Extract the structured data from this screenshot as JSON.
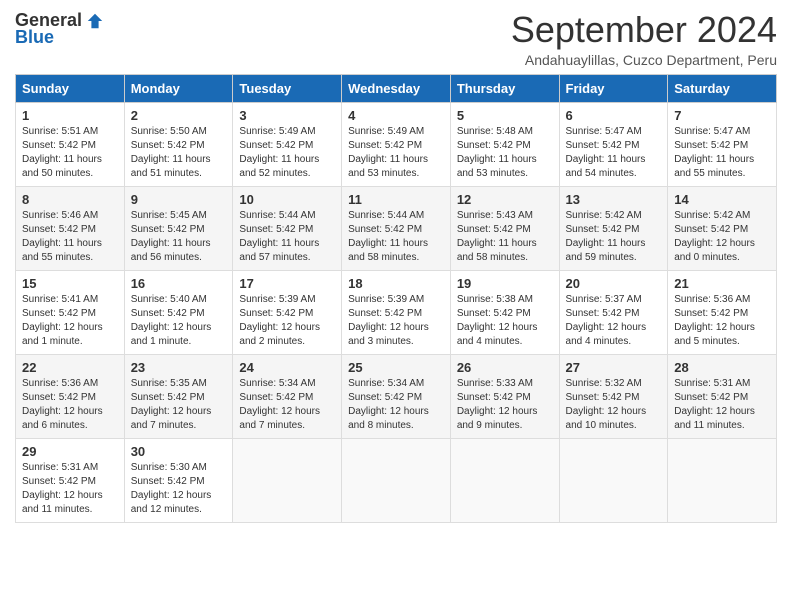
{
  "header": {
    "logo_general": "General",
    "logo_blue": "Blue",
    "month_title": "September 2024",
    "location": "Andahuaylillas, Cuzco Department, Peru"
  },
  "weekdays": [
    "Sunday",
    "Monday",
    "Tuesday",
    "Wednesday",
    "Thursday",
    "Friday",
    "Saturday"
  ],
  "weeks": [
    [
      {
        "day": "1",
        "sunrise": "5:51 AM",
        "sunset": "5:42 PM",
        "daylight": "11 hours and 50 minutes."
      },
      {
        "day": "2",
        "sunrise": "5:50 AM",
        "sunset": "5:42 PM",
        "daylight": "11 hours and 51 minutes."
      },
      {
        "day": "3",
        "sunrise": "5:49 AM",
        "sunset": "5:42 PM",
        "daylight": "11 hours and 52 minutes."
      },
      {
        "day": "4",
        "sunrise": "5:49 AM",
        "sunset": "5:42 PM",
        "daylight": "11 hours and 53 minutes."
      },
      {
        "day": "5",
        "sunrise": "5:48 AM",
        "sunset": "5:42 PM",
        "daylight": "11 hours and 53 minutes."
      },
      {
        "day": "6",
        "sunrise": "5:47 AM",
        "sunset": "5:42 PM",
        "daylight": "11 hours and 54 minutes."
      },
      {
        "day": "7",
        "sunrise": "5:47 AM",
        "sunset": "5:42 PM",
        "daylight": "11 hours and 55 minutes."
      }
    ],
    [
      {
        "day": "8",
        "sunrise": "5:46 AM",
        "sunset": "5:42 PM",
        "daylight": "11 hours and 55 minutes."
      },
      {
        "day": "9",
        "sunrise": "5:45 AM",
        "sunset": "5:42 PM",
        "daylight": "11 hours and 56 minutes."
      },
      {
        "day": "10",
        "sunrise": "5:44 AM",
        "sunset": "5:42 PM",
        "daylight": "11 hours and 57 minutes."
      },
      {
        "day": "11",
        "sunrise": "5:44 AM",
        "sunset": "5:42 PM",
        "daylight": "11 hours and 58 minutes."
      },
      {
        "day": "12",
        "sunrise": "5:43 AM",
        "sunset": "5:42 PM",
        "daylight": "11 hours and 58 minutes."
      },
      {
        "day": "13",
        "sunrise": "5:42 AM",
        "sunset": "5:42 PM",
        "daylight": "11 hours and 59 minutes."
      },
      {
        "day": "14",
        "sunrise": "5:42 AM",
        "sunset": "5:42 PM",
        "daylight": "12 hours and 0 minutes."
      }
    ],
    [
      {
        "day": "15",
        "sunrise": "5:41 AM",
        "sunset": "5:42 PM",
        "daylight": "12 hours and 1 minute."
      },
      {
        "day": "16",
        "sunrise": "5:40 AM",
        "sunset": "5:42 PM",
        "daylight": "12 hours and 1 minute."
      },
      {
        "day": "17",
        "sunrise": "5:39 AM",
        "sunset": "5:42 PM",
        "daylight": "12 hours and 2 minutes."
      },
      {
        "day": "18",
        "sunrise": "5:39 AM",
        "sunset": "5:42 PM",
        "daylight": "12 hours and 3 minutes."
      },
      {
        "day": "19",
        "sunrise": "5:38 AM",
        "sunset": "5:42 PM",
        "daylight": "12 hours and 4 minutes."
      },
      {
        "day": "20",
        "sunrise": "5:37 AM",
        "sunset": "5:42 PM",
        "daylight": "12 hours and 4 minutes."
      },
      {
        "day": "21",
        "sunrise": "5:36 AM",
        "sunset": "5:42 PM",
        "daylight": "12 hours and 5 minutes."
      }
    ],
    [
      {
        "day": "22",
        "sunrise": "5:36 AM",
        "sunset": "5:42 PM",
        "daylight": "12 hours and 6 minutes."
      },
      {
        "day": "23",
        "sunrise": "5:35 AM",
        "sunset": "5:42 PM",
        "daylight": "12 hours and 7 minutes."
      },
      {
        "day": "24",
        "sunrise": "5:34 AM",
        "sunset": "5:42 PM",
        "daylight": "12 hours and 7 minutes."
      },
      {
        "day": "25",
        "sunrise": "5:34 AM",
        "sunset": "5:42 PM",
        "daylight": "12 hours and 8 minutes."
      },
      {
        "day": "26",
        "sunrise": "5:33 AM",
        "sunset": "5:42 PM",
        "daylight": "12 hours and 9 minutes."
      },
      {
        "day": "27",
        "sunrise": "5:32 AM",
        "sunset": "5:42 PM",
        "daylight": "12 hours and 10 minutes."
      },
      {
        "day": "28",
        "sunrise": "5:31 AM",
        "sunset": "5:42 PM",
        "daylight": "12 hours and 11 minutes."
      }
    ],
    [
      {
        "day": "29",
        "sunrise": "5:31 AM",
        "sunset": "5:42 PM",
        "daylight": "12 hours and 11 minutes."
      },
      {
        "day": "30",
        "sunrise": "5:30 AM",
        "sunset": "5:42 PM",
        "daylight": "12 hours and 12 minutes."
      },
      null,
      null,
      null,
      null,
      null
    ]
  ]
}
